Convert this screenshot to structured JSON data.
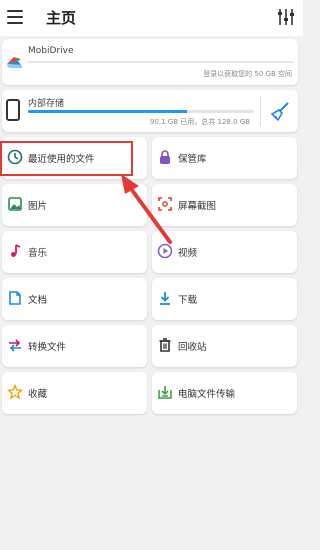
{
  "header": {
    "title": "主页"
  },
  "cloud": {
    "name": "MobiDrive",
    "status": "登录以获取您的 50 GB 空间"
  },
  "storage": {
    "name": "内部存储",
    "used_fraction": 0.703,
    "status": "90.1 GB 已用，总共 128.0 GB"
  },
  "tiles": [
    {
      "label": "最近使用的文件",
      "icon": "clock-icon",
      "color": "#2a6b74"
    },
    {
      "label": "保管库",
      "icon": "vault-lock-icon",
      "color": "#7e57c2"
    },
    {
      "label": "图片",
      "icon": "image-icon",
      "color": "#2e8b57"
    },
    {
      "label": "屏幕截图",
      "icon": "screenshot-icon",
      "color": "#e53935"
    },
    {
      "label": "音乐",
      "icon": "music-note-icon",
      "color": "#d81b60"
    },
    {
      "label": "视频",
      "icon": "play-circle-icon",
      "color": "#8e5cc7"
    },
    {
      "label": "文档",
      "icon": "document-icon",
      "color": "#1e88e5"
    },
    {
      "label": "下载",
      "icon": "download-icon",
      "color": "#1e88e5"
    },
    {
      "label": "转换文件",
      "icon": "convert-arrows-icon",
      "color": "#c2185b"
    },
    {
      "label": "回收站",
      "icon": "trash-icon",
      "color": "#333333"
    },
    {
      "label": "收藏",
      "icon": "star-icon",
      "color": "#f0a500"
    },
    {
      "label": "电脑文件传输",
      "icon": "pc-transfer-icon",
      "color": "#43a047"
    }
  ],
  "colors": {
    "accent": "#2196f3",
    "annotation": "#e53935"
  }
}
